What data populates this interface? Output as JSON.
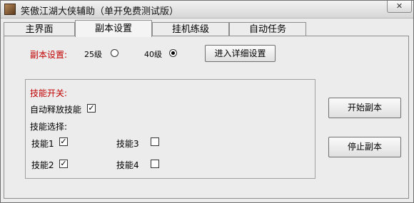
{
  "window": {
    "title": "笑傲江湖大侠辅助（单开免费测试版）",
    "close_glyph": "✕"
  },
  "tabs": [
    {
      "label": "主界面"
    },
    {
      "label": "副本设置"
    },
    {
      "label": "挂机练级"
    },
    {
      "label": "自动任务"
    }
  ],
  "active_tab": "副本设置",
  "dungeon": {
    "setting_label": "副本设置:",
    "options": [
      {
        "label": "25级",
        "selected": false
      },
      {
        "label": "40级",
        "selected": true
      }
    ],
    "detail_button": "进入详细设置"
  },
  "skills": {
    "switch_label": "技能开关:",
    "auto_release_label": "自动释放技能",
    "auto_release_checked": true,
    "select_label": "技能选择:",
    "items": [
      {
        "label": "技能1",
        "checked": true
      },
      {
        "label": "技能2",
        "checked": true
      },
      {
        "label": "技能3",
        "checked": false
      },
      {
        "label": "技能4",
        "checked": false
      }
    ]
  },
  "actions": {
    "start_label": "开始副本",
    "stop_label": "停止副本"
  },
  "colors": {
    "accent_red": "#c00000",
    "window_bg": "#ececec"
  }
}
